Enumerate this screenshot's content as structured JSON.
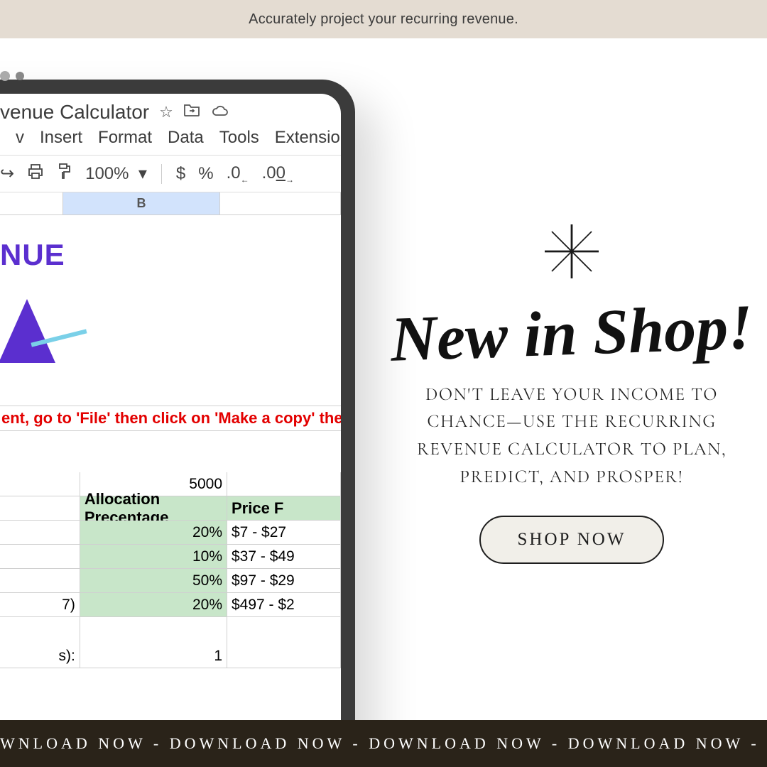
{
  "banner": {
    "text": "Accurately project your recurring revenue."
  },
  "tablet": {
    "doc_title": "venue Calculator",
    "menus": [
      "Insert",
      "Format",
      "Data",
      "Tools",
      "Extensions"
    ],
    "toolbar": {
      "zoom": "100%",
      "currency": "$",
      "percent": "%"
    },
    "columns": {
      "b": "B"
    },
    "nue": "NUE",
    "instruction": "ent, go to 'File' then click on 'Make a copy' then",
    "val_5000": "5000",
    "headers": {
      "alloc": "Allocation Precentage",
      "price": "Price F"
    },
    "rows": [
      {
        "percent": "20%",
        "price": "$7 - $27"
      },
      {
        "percent": "10%",
        "price": "$37 - $49"
      },
      {
        "percent": "50%",
        "price": "$97 - $29"
      },
      {
        "percent": "20%",
        "price": "$497 - $2"
      }
    ],
    "row_labels": {
      "a": "7)",
      "b": "s):"
    },
    "val_1": "1"
  },
  "promo": {
    "heading": "New in Shop!",
    "subcopy": "DON'T LEAVE YOUR INCOME TO CHANCE—USE THE RECURRING REVENUE CALCULATOR TO PLAN, PREDICT, AND PROSPER!",
    "button": "SHOP NOW"
  },
  "marquee": {
    "text": "WNLOAD NOW - DOWNLOAD NOW - DOWNLOAD NOW - DOWNLOAD NOW - DOWNLOAD N"
  }
}
